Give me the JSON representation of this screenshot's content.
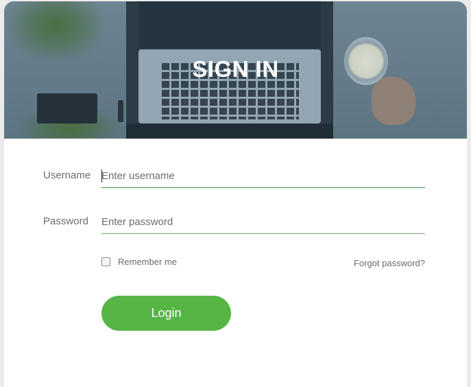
{
  "header": {
    "title": "SIGN IN"
  },
  "form": {
    "username": {
      "label": "Username",
      "placeholder": "Enter username",
      "value": ""
    },
    "password": {
      "label": "Password",
      "placeholder": "Enter password",
      "value": ""
    },
    "remember_label": "Remember me",
    "remember_checked": false,
    "forgot_label": "Forgot password?",
    "login_label": "Login"
  },
  "colors": {
    "accent": "#56b545",
    "hero_overlay": "#5d7482",
    "underline": "#6aa56a"
  }
}
